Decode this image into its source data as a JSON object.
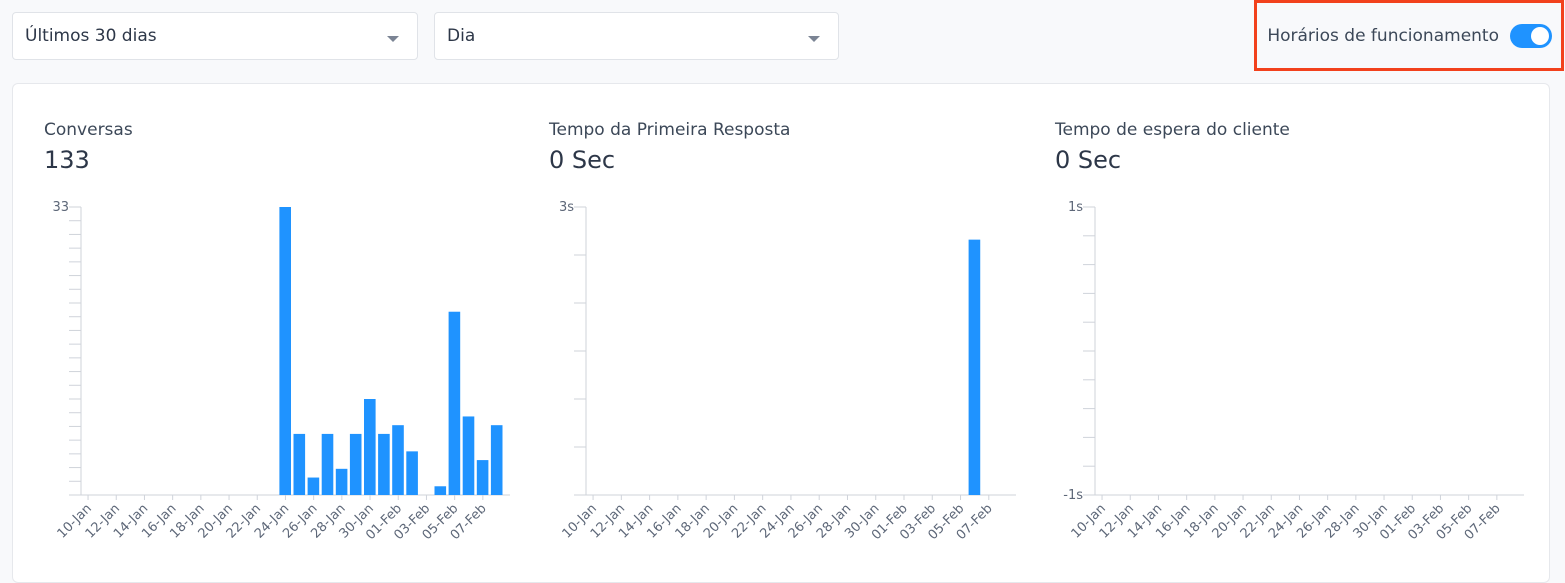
{
  "filters": {
    "period": {
      "value": "Últimos 30 dias"
    },
    "grouping": {
      "value": "Dia"
    }
  },
  "business_hours": {
    "label": "Horários de funcionamento",
    "enabled": true
  },
  "metrics": [
    {
      "title": "Conversas",
      "value": "133"
    },
    {
      "title": "Tempo da Primeira Resposta",
      "value": "0 Sec"
    },
    {
      "title": "Tempo de espera do cliente",
      "value": "0 Sec"
    }
  ],
  "colors": {
    "bar": "#1f93ff",
    "highlight": "#f2411c",
    "toggle": "#1f93ff"
  },
  "chart_data": [
    {
      "type": "bar",
      "ylim": [
        0,
        33
      ],
      "yticklabels": [
        {
          "value": 33,
          "label": "33"
        }
      ],
      "xticklabels": [
        "10-Jan",
        "12-Jan",
        "14-Jan",
        "16-Jan",
        "18-Jan",
        "20-Jan",
        "22-Jan",
        "24-Jan",
        "26-Jan",
        "28-Jan",
        "30-Jan",
        "01-Feb",
        "03-Feb",
        "05-Feb",
        "07-Feb"
      ],
      "categories": [
        "10-Jan",
        "11-Jan",
        "12-Jan",
        "13-Jan",
        "14-Jan",
        "15-Jan",
        "16-Jan",
        "17-Jan",
        "18-Jan",
        "19-Jan",
        "20-Jan",
        "21-Jan",
        "22-Jan",
        "23-Jan",
        "24-Jan",
        "25-Jan",
        "26-Jan",
        "27-Jan",
        "28-Jan",
        "29-Jan",
        "30-Jan",
        "31-Jan",
        "01-Feb",
        "02-Feb",
        "03-Feb",
        "04-Feb",
        "05-Feb",
        "06-Feb",
        "07-Feb",
        "08-Feb"
      ],
      "values": [
        0,
        0,
        0,
        0,
        0,
        0,
        0,
        0,
        0,
        0,
        0,
        0,
        0,
        0,
        33,
        7,
        2,
        7,
        3,
        7,
        11,
        7,
        8,
        5,
        0,
        1,
        21,
        9,
        4,
        8
      ]
    },
    {
      "type": "bar",
      "ylim": [
        0,
        3
      ],
      "yticklabels": [
        {
          "value": 3,
          "label": "3s"
        }
      ],
      "xticklabels": [
        "10-Jan",
        "12-Jan",
        "14-Jan",
        "16-Jan",
        "18-Jan",
        "20-Jan",
        "22-Jan",
        "24-Jan",
        "26-Jan",
        "28-Jan",
        "30-Jan",
        "01-Feb",
        "03-Feb",
        "05-Feb",
        "07-Feb"
      ],
      "categories": [
        "10-Jan",
        "11-Jan",
        "12-Jan",
        "13-Jan",
        "14-Jan",
        "15-Jan",
        "16-Jan",
        "17-Jan",
        "18-Jan",
        "19-Jan",
        "20-Jan",
        "21-Jan",
        "22-Jan",
        "23-Jan",
        "24-Jan",
        "25-Jan",
        "26-Jan",
        "27-Jan",
        "28-Jan",
        "29-Jan",
        "30-Jan",
        "31-Jan",
        "01-Feb",
        "02-Feb",
        "03-Feb",
        "04-Feb",
        "05-Feb",
        "06-Feb",
        "07-Feb",
        "08-Feb"
      ],
      "values": [
        0,
        0,
        0,
        0,
        0,
        0,
        0,
        0,
        0,
        0,
        0,
        0,
        0,
        0,
        0,
        0,
        0,
        0,
        0,
        0,
        0,
        0,
        0,
        0,
        0,
        0,
        0,
        2.66,
        0,
        0
      ]
    },
    {
      "type": "bar",
      "ylim": [
        -1,
        1
      ],
      "yticklabels": [
        {
          "value": 1,
          "label": "1s"
        },
        {
          "value": -1,
          "label": "-1s"
        }
      ],
      "xticklabels": [
        "10-Jan",
        "12-Jan",
        "14-Jan",
        "16-Jan",
        "18-Jan",
        "20-Jan",
        "22-Jan",
        "24-Jan",
        "26-Jan",
        "28-Jan",
        "30-Jan",
        "01-Feb",
        "03-Feb",
        "05-Feb",
        "07-Feb"
      ],
      "categories": [
        "10-Jan",
        "11-Jan",
        "12-Jan",
        "13-Jan",
        "14-Jan",
        "15-Jan",
        "16-Jan",
        "17-Jan",
        "18-Jan",
        "19-Jan",
        "20-Jan",
        "21-Jan",
        "22-Jan",
        "23-Jan",
        "24-Jan",
        "25-Jan",
        "26-Jan",
        "27-Jan",
        "28-Jan",
        "29-Jan",
        "30-Jan",
        "31-Jan",
        "01-Feb",
        "02-Feb",
        "03-Feb",
        "04-Feb",
        "05-Feb",
        "06-Feb",
        "07-Feb",
        "08-Feb"
      ],
      "values": [
        0,
        0,
        0,
        0,
        0,
        0,
        0,
        0,
        0,
        0,
        0,
        0,
        0,
        0,
        0,
        0,
        0,
        0,
        0,
        0,
        0,
        0,
        0,
        0,
        0,
        0,
        0,
        0,
        0,
        0
      ]
    }
  ]
}
